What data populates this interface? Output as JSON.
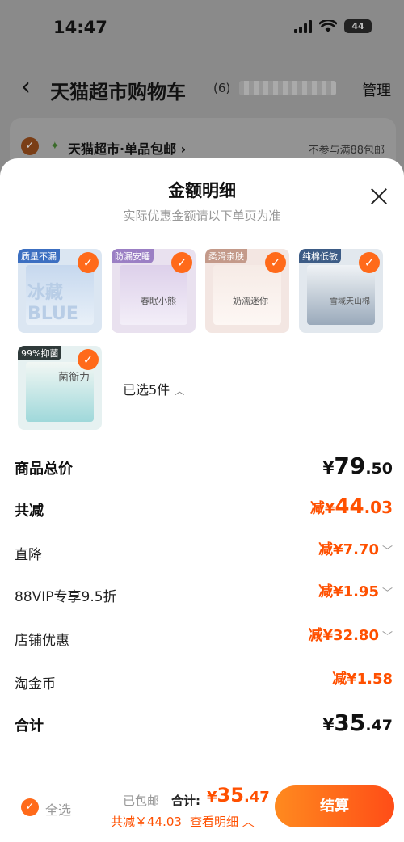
{
  "status_bar": {
    "time": "14:47",
    "battery": "44"
  },
  "nav": {
    "title": "天猫超市购物车",
    "count": "(6)",
    "manage": "管理"
  },
  "store": {
    "name": "天猫超市·单品包邮",
    "chevron": "›",
    "note": "不参与满88包邮"
  },
  "sheet": {
    "title": "金额明细",
    "subtitle": "实际优惠金额请以下单页为准"
  },
  "products": [
    {
      "tag": "质量不漏",
      "text": "冰藏 BLUE"
    },
    {
      "tag": "防漏安睡",
      "text": "春眠小熊"
    },
    {
      "tag": "柔滑亲肤",
      "text": "奶濡迷你"
    },
    {
      "tag": "纯棉低敏",
      "text": "雪域天山棉"
    },
    {
      "tag": "99%抑菌",
      "text": "菌衡力"
    }
  ],
  "selected_text": "已选5件",
  "rows": {
    "subtotal": {
      "label": "商品总价",
      "yen": "¥",
      "int": "79",
      "dec": ".50"
    },
    "total_discount": {
      "label": "共减",
      "prefix": "减",
      "yen": "¥",
      "int": "44",
      "dec": ".03"
    },
    "direct": {
      "label": "直降",
      "value": "减¥7.70"
    },
    "vip": {
      "label": "88VIP专享9.5折",
      "value": "减¥1.95"
    },
    "store": {
      "label": "店铺优惠",
      "value": "减¥32.80"
    },
    "coins": {
      "label": "淘金币",
      "value": "减¥1.58"
    },
    "total": {
      "label": "合计",
      "yen": "¥",
      "int": "35",
      "dec": ".47"
    }
  },
  "bottom": {
    "select_all": "全选",
    "postage": "已包邮",
    "total_label": "合计:",
    "total_yen": "¥",
    "total_int": "35",
    "total_dec": ".47",
    "saving": "共减￥44.03",
    "details": "查看明细",
    "checkout": "结算"
  },
  "colors": {
    "accent": "#ff5000",
    "check": "#ff6a1a",
    "button_start": "#ff8a1f",
    "button_end": "#ff4d17"
  }
}
